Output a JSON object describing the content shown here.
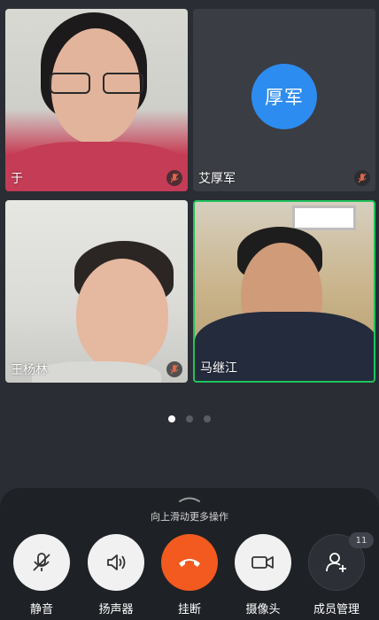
{
  "participants": [
    {
      "name": "于",
      "video": true,
      "muted": true
    },
    {
      "name": "艾厚军",
      "avatar_text": "厚军",
      "video": false,
      "muted": true
    },
    {
      "name": "王杨林",
      "video": true,
      "muted": true
    },
    {
      "name": "马继江",
      "video": true,
      "muted": false,
      "speaking": true
    }
  ],
  "pager": {
    "count": 3,
    "active": 0
  },
  "panel": {
    "hint": "向上滑动更多操作",
    "controls": [
      {
        "label": "静音",
        "icon": "mic-off-icon"
      },
      {
        "label": "扬声器",
        "icon": "speaker-icon"
      },
      {
        "label": "挂断",
        "icon": "hangup-icon"
      },
      {
        "label": "摄像头",
        "icon": "camera-icon"
      },
      {
        "label": "成员管理",
        "icon": "member-add-icon",
        "badge": "11"
      }
    ]
  },
  "colors": {
    "background": "#2a2d33",
    "panel": "#1e2126",
    "avatar": "#2d8cf0",
    "hangup": "#f35a1f",
    "active_speaker_border": "#1fc35b"
  }
}
